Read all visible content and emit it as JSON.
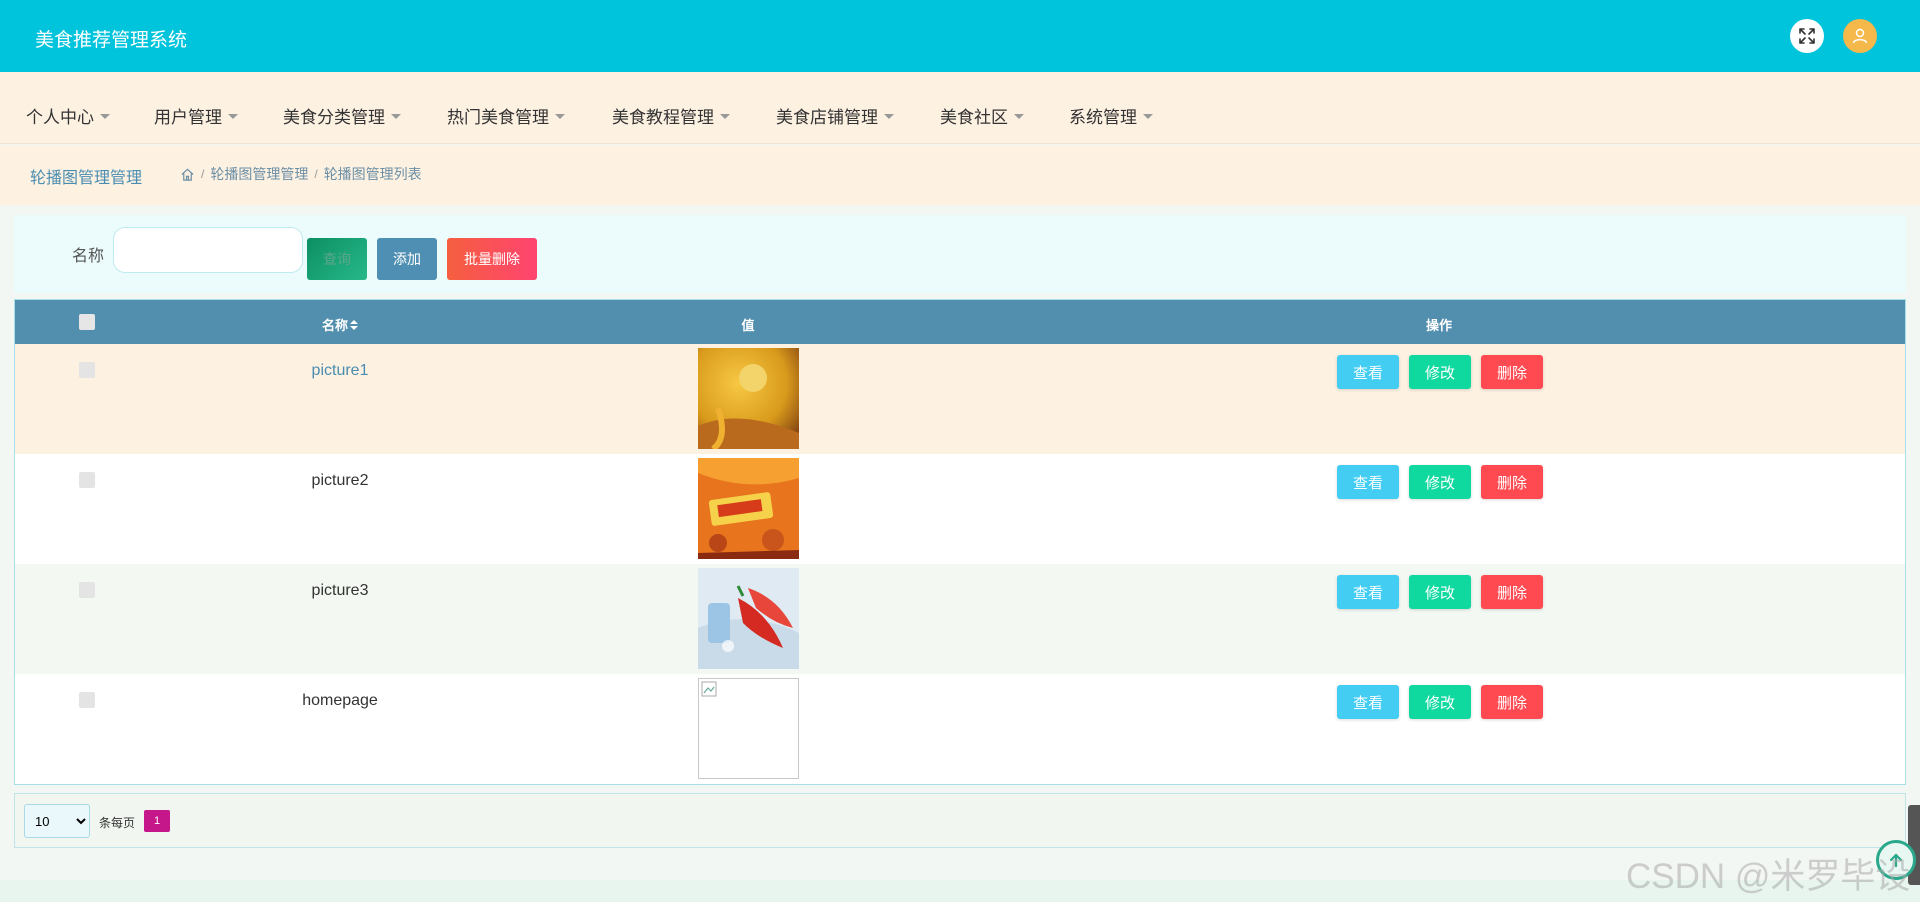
{
  "app": {
    "title": "美食推荐管理系统"
  },
  "header": {
    "icons": [
      "fullscreen-icon",
      "user-avatar-icon"
    ],
    "bg_color": "#00c3dc"
  },
  "nav": {
    "items": [
      {
        "label": "个人中心"
      },
      {
        "label": "用户管理"
      },
      {
        "label": "美食分类管理"
      },
      {
        "label": "热门美食管理"
      },
      {
        "label": "美食教程管理"
      },
      {
        "label": "美食店铺管理"
      },
      {
        "label": "美食社区"
      },
      {
        "label": "系统管理"
      }
    ]
  },
  "breadcrumb": {
    "title": "轮播图管理管理",
    "path": [
      "轮播图管理管理",
      "轮播图管理列表"
    ],
    "separator": "/"
  },
  "search": {
    "label": "名称",
    "value": "",
    "placeholder": "",
    "query_label": "查询",
    "add_label": "添加",
    "batch_delete_label": "批量删除"
  },
  "table": {
    "headers": {
      "name": "名称",
      "sort_icon": "sort-icon",
      "value": "值",
      "actions": "操作"
    },
    "rows": [
      {
        "name": "picture1",
        "image": "soup-food-photo",
        "highlight_color": "#fdf1e2"
      },
      {
        "name": "picture2",
        "image": "food-banner-photo",
        "highlight_color": "#ffffff"
      },
      {
        "name": "picture3",
        "image": "red-chili-photo",
        "highlight_color": "#f3f8f2"
      },
      {
        "name": "homepage",
        "image": "broken-image",
        "highlight_color": "#ffffff"
      }
    ],
    "action_labels": {
      "view": "查看",
      "edit": "修改",
      "delete": "删除"
    }
  },
  "pagination": {
    "page_size": "10",
    "page_size_options": [
      "10"
    ],
    "per_page_label": "条每页",
    "current_page": "1"
  },
  "watermark": "CSDN @米罗毕设"
}
